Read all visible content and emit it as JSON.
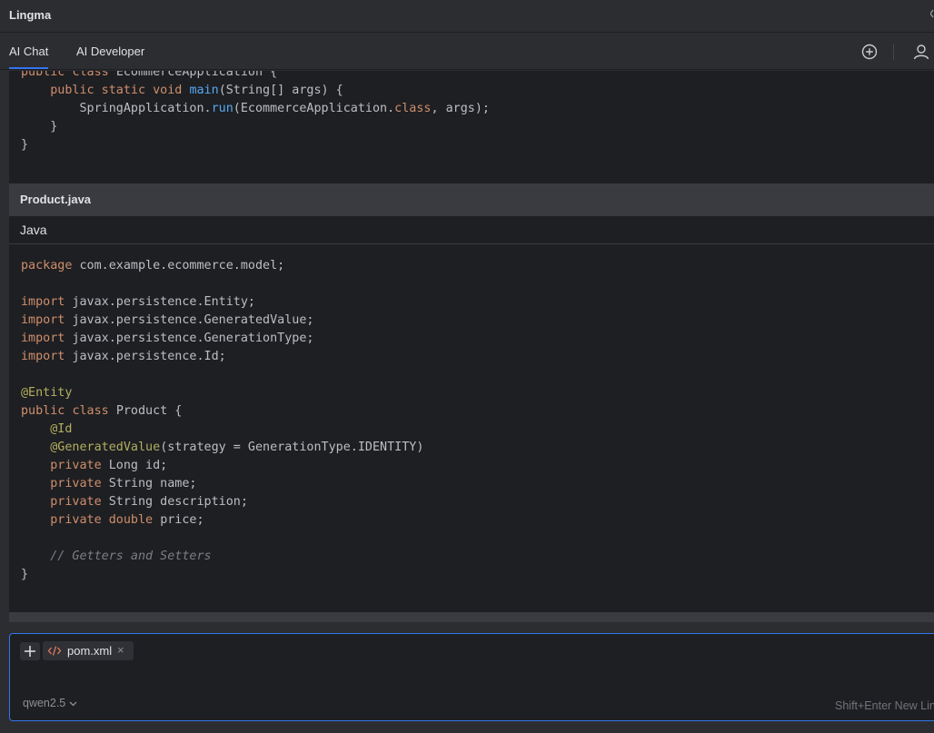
{
  "app": {
    "title": "Lingma"
  },
  "tabs": [
    {
      "label": "AI Chat",
      "active": true
    },
    {
      "label": "AI Developer",
      "active": false
    }
  ],
  "toolbar": {
    "icons": [
      "new-chat-icon",
      "user-icon"
    ]
  },
  "snippet1": {
    "lines": [
      [
        [
          "kw",
          "public "
        ],
        [
          "kw",
          "class "
        ],
        [
          "pl",
          "EcommerceApplication {"
        ]
      ],
      [
        [
          "pl",
          "    "
        ],
        [
          "kw",
          "public static void "
        ],
        [
          "fn",
          "main"
        ],
        [
          "pl",
          "(String[] args) {"
        ]
      ],
      [
        [
          "pl",
          "        SpringApplication."
        ],
        [
          "fn",
          "run"
        ],
        [
          "pl",
          "(EcommerceApplication."
        ],
        [
          "kw",
          "class"
        ],
        [
          "pl",
          ", args);"
        ]
      ],
      [
        [
          "pl",
          "    }"
        ]
      ],
      [
        [
          "pl",
          "}"
        ]
      ]
    ]
  },
  "file": {
    "name": "Product.java",
    "language": "Java"
  },
  "snippet2": {
    "lines": [
      [
        [
          "kw",
          "package "
        ],
        [
          "pl",
          "com.example.ecommerce.model;"
        ]
      ],
      [],
      [
        [
          "kw",
          "import "
        ],
        [
          "pl",
          "javax.persistence.Entity;"
        ]
      ],
      [
        [
          "kw",
          "import "
        ],
        [
          "pl",
          "javax.persistence.GeneratedValue;"
        ]
      ],
      [
        [
          "kw",
          "import "
        ],
        [
          "pl",
          "javax.persistence.GenerationType;"
        ]
      ],
      [
        [
          "kw",
          "import "
        ],
        [
          "pl",
          "javax.persistence.Id;"
        ]
      ],
      [],
      [
        [
          "an",
          "@Entity"
        ]
      ],
      [
        [
          "kw",
          "public "
        ],
        [
          "kw",
          "class "
        ],
        [
          "pl",
          "Product {"
        ]
      ],
      [
        [
          "pl",
          "    "
        ],
        [
          "an",
          "@Id"
        ]
      ],
      [
        [
          "pl",
          "    "
        ],
        [
          "an",
          "@GeneratedValue"
        ],
        [
          "pl",
          "(strategy = GenerationType.IDENTITY)"
        ]
      ],
      [
        [
          "pl",
          "    "
        ],
        [
          "kw",
          "private "
        ],
        [
          "pl",
          "Long id;"
        ]
      ],
      [
        [
          "pl",
          "    "
        ],
        [
          "kw",
          "private "
        ],
        [
          "pl",
          "String name;"
        ]
      ],
      [
        [
          "pl",
          "    "
        ],
        [
          "kw",
          "private "
        ],
        [
          "pl",
          "String description;"
        ]
      ],
      [
        [
          "pl",
          "    "
        ],
        [
          "kw",
          "private "
        ],
        [
          "kw",
          "double "
        ],
        [
          "pl",
          "price;"
        ]
      ],
      [],
      [
        [
          "pl",
          "    "
        ],
        [
          "cm",
          "// Getters and Setters"
        ]
      ],
      [
        [
          "pl",
          "}"
        ]
      ]
    ]
  },
  "input": {
    "attachment": "pom.xml",
    "attachment_close": "×",
    "add_icon": "plus-icon",
    "model": "qwen2.5",
    "hint": "Shift+Enter New Lin"
  },
  "colors": {
    "accent": "#3574f0",
    "keyword": "#cf8e6d",
    "function": "#56a8f5",
    "annotation": "#b3ae60"
  }
}
